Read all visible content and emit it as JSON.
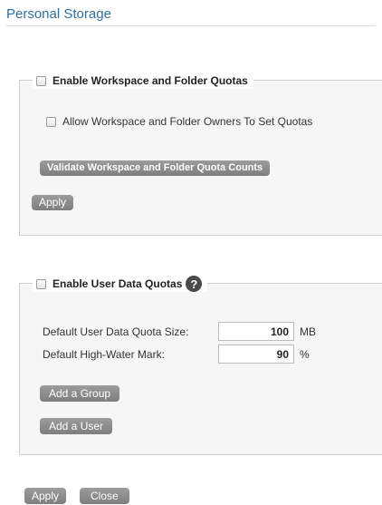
{
  "page": {
    "title": "Personal Storage"
  },
  "workspace_quotas": {
    "legend_label": "Enable Workspace and Folder Quotas",
    "owner_option_label": "Allow Workspace and Folder Owners To Set Quotas",
    "validate_button_label": "Validate Workspace and Folder Quota Counts",
    "apply_button_label": "Apply"
  },
  "user_quotas": {
    "legend_label": "Enable User Data Quotas",
    "help_icon_glyph": "?",
    "default_size_label": "Default User Data Quota Size:",
    "default_size_value": "100",
    "default_size_unit": "MB",
    "high_water_label": "Default High-Water Mark:",
    "high_water_value": "90",
    "high_water_unit": "%",
    "add_group_label": "Add a Group",
    "add_user_label": "Add a User"
  },
  "footer": {
    "apply_label": "Apply",
    "close_label": "Close"
  },
  "colors": {
    "title": "#2f6f9f",
    "button": "#8a8a8a",
    "panel": "#f6f6f6"
  },
  "icons": {
    "help": "question-circle-icon",
    "checkbox": "checkbox-unchecked-icon"
  }
}
